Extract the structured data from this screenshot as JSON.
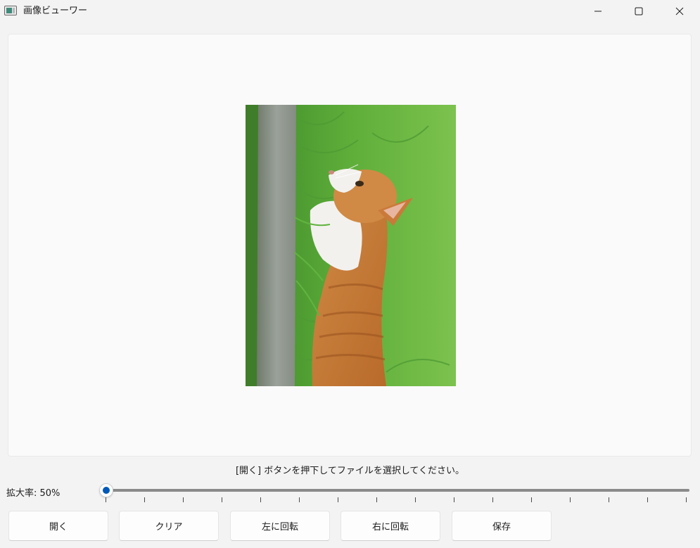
{
  "window": {
    "title": "画像ビューワー",
    "controls": {
      "minimize_icon": "minimize-icon",
      "maximize_icon": "maximize-icon",
      "close_icon": "close-icon"
    }
  },
  "viewer": {
    "image_description": "cat-photo-rotated",
    "background": "#fafafa"
  },
  "status": {
    "message": "[開く] ボタンを押下してファイルを選択してください。"
  },
  "zoom": {
    "label": "拡大率: 50%",
    "value_percent": 50,
    "slider_position_fraction": 0.0,
    "tick_count": 16,
    "accent_color": "#0058b8"
  },
  "toolbar": {
    "open_label": "開く",
    "clear_label": "クリア",
    "rotate_left_label": "左に回転",
    "rotate_right_label": "右に回転",
    "save_label": "保存"
  }
}
